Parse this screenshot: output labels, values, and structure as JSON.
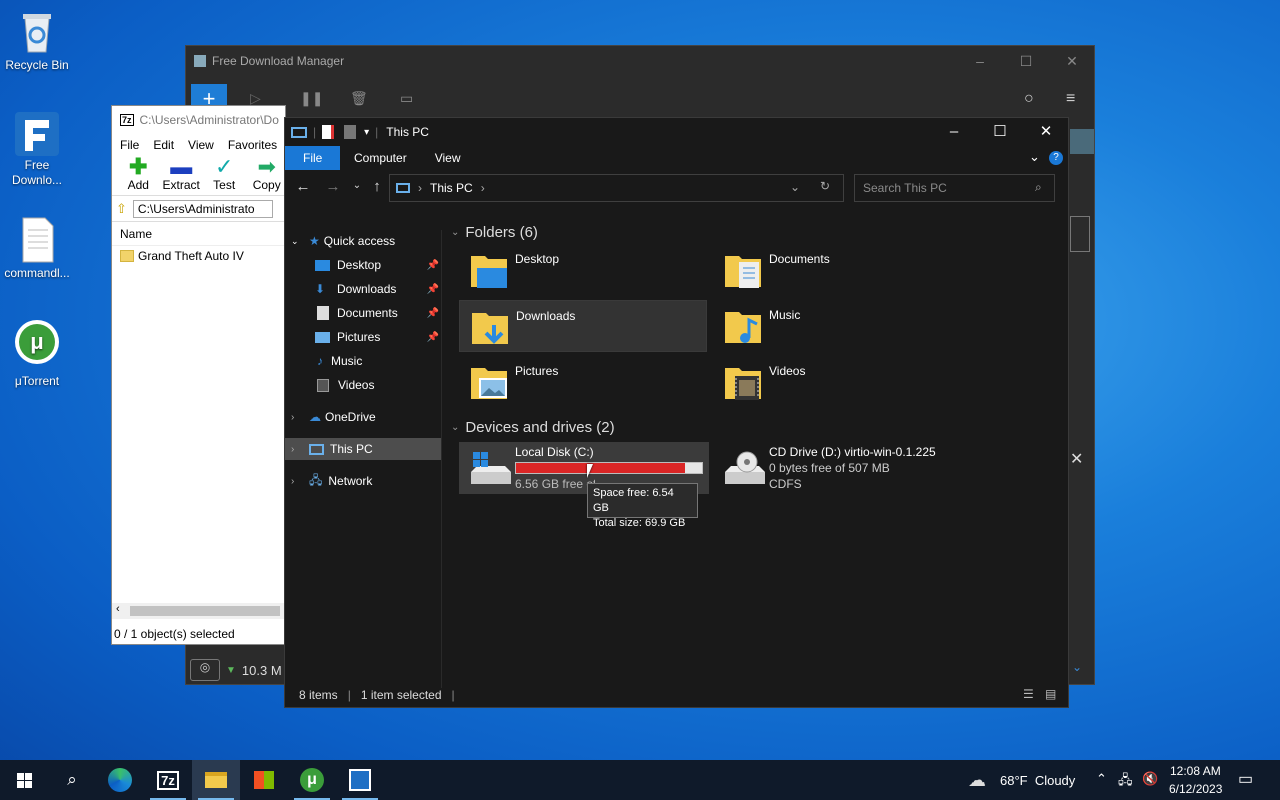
{
  "desktop": {
    "icons": [
      {
        "label": "Recycle Bin"
      },
      {
        "label": "Free Downlo..."
      },
      {
        "label": "commandl..."
      },
      {
        "label": "μTorrent"
      }
    ]
  },
  "fdm": {
    "title": "Free Download Manager",
    "speed": "10.3 M"
  },
  "sevenzip": {
    "title": "C:\\Users\\Administrator\\Do",
    "menu": [
      "File",
      "Edit",
      "View",
      "Favorites"
    ],
    "tools": [
      "Add",
      "Extract",
      "Test",
      "Copy"
    ],
    "path": "C:\\Users\\Administrato",
    "col_name": "Name",
    "rows": [
      {
        "name": "Grand Theft Auto IV"
      }
    ],
    "status": "0 / 1 object(s) selected"
  },
  "explorer": {
    "title": "This PC",
    "ribbon_tabs": [
      "File",
      "Computer",
      "View"
    ],
    "address": "This PC",
    "search_placeholder": "Search This PC",
    "nav": [
      {
        "label": "Quick access"
      },
      {
        "label": "Desktop"
      },
      {
        "label": "Downloads"
      },
      {
        "label": "Documents"
      },
      {
        "label": "Pictures"
      },
      {
        "label": "Music"
      },
      {
        "label": "Videos"
      },
      {
        "label": "OneDrive"
      },
      {
        "label": "This PC"
      },
      {
        "label": "Network"
      }
    ],
    "folders_header": "Folders (6)",
    "folders": [
      {
        "name": "Desktop"
      },
      {
        "name": "Documents"
      },
      {
        "name": "Downloads"
      },
      {
        "name": "Music"
      },
      {
        "name": "Pictures"
      },
      {
        "name": "Videos"
      }
    ],
    "devices_header": "Devices and drives (2)",
    "drives": [
      {
        "name": "Local Disk (C:)",
        "free_text": "6.56 GB free of 69.9 GB",
        "used_fraction": 0.906
      },
      {
        "name": "CD Drive (D:) virtio-win-0.1.225",
        "free_text": "0 bytes free of 507 MB",
        "fs": "CDFS"
      }
    ],
    "tooltip": {
      "line1": "Space free: 6.54 GB",
      "line2": "Total size: 69.9 GB"
    },
    "status": {
      "items": "8 items",
      "selected": "1 item selected"
    }
  },
  "taskbar": {
    "weather": "68°F  Cloudy",
    "time": "12:08 AM",
    "date": "6/12/2023"
  },
  "colors": {
    "drive_bar": "#da2626",
    "accent": "#0a64c8"
  }
}
